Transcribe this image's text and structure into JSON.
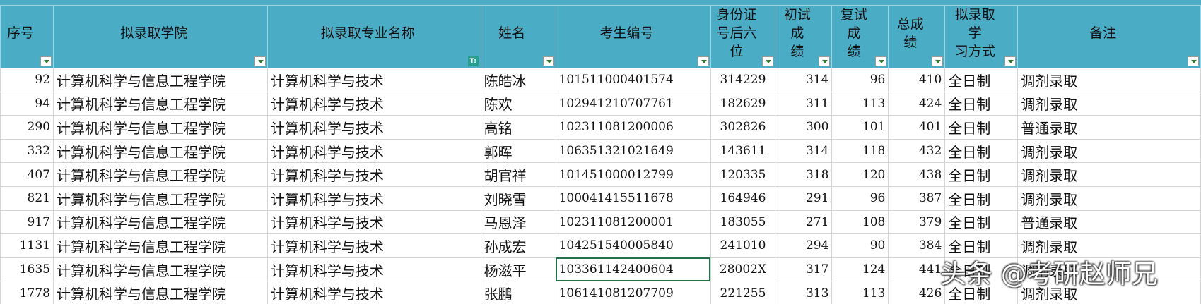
{
  "columns": [
    {
      "key": "seq",
      "label": "序号"
    },
    {
      "key": "college",
      "label": "拟录取学院"
    },
    {
      "key": "major",
      "label": "拟录取专业名称"
    },
    {
      "key": "name",
      "label": "姓名"
    },
    {
      "key": "exam_no",
      "label": "考生编号"
    },
    {
      "key": "id6",
      "label": "身份证\n号后六\n位"
    },
    {
      "key": "first",
      "label": "初试成\n绩"
    },
    {
      "key": "retest",
      "label": "复试成\n绩"
    },
    {
      "key": "total",
      "label": "总成\n绩"
    },
    {
      "key": "mode",
      "label": "拟录取学\n习方式"
    },
    {
      "key": "note",
      "label": "备注"
    }
  ],
  "rows": [
    {
      "seq": "92",
      "college": "计算机科学与信息工程学院",
      "major": "计算机科学与技术",
      "name": "陈皓冰",
      "exam_no": "101511000401574",
      "id6": "314229",
      "first": "314",
      "retest": "96",
      "total": "410",
      "mode": "全日制",
      "note": "调剂录取"
    },
    {
      "seq": "94",
      "college": "计算机科学与信息工程学院",
      "major": "计算机科学与技术",
      "name": "陈欢",
      "exam_no": "102941210707761",
      "id6": "182629",
      "first": "311",
      "retest": "113",
      "total": "424",
      "mode": "全日制",
      "note": "调剂录取"
    },
    {
      "seq": "290",
      "college": "计算机科学与信息工程学院",
      "major": "计算机科学与技术",
      "name": "高铭",
      "exam_no": "102311081200006",
      "id6": "302826",
      "first": "300",
      "retest": "101",
      "total": "401",
      "mode": "全日制",
      "note": "普通录取"
    },
    {
      "seq": "332",
      "college": "计算机科学与信息工程学院",
      "major": "计算机科学与技术",
      "name": "郭晖",
      "exam_no": "106351321021649",
      "id6": "143611",
      "first": "314",
      "retest": "118",
      "total": "432",
      "mode": "全日制",
      "note": "调剂录取"
    },
    {
      "seq": "407",
      "college": "计算机科学与信息工程学院",
      "major": "计算机科学与技术",
      "name": "胡官祥",
      "exam_no": "101451000012799",
      "id6": "120335",
      "first": "318",
      "retest": "120",
      "total": "438",
      "mode": "全日制",
      "note": "调剂录取"
    },
    {
      "seq": "821",
      "college": "计算机科学与信息工程学院",
      "major": "计算机科学与技术",
      "name": "刘晓雪",
      "exam_no": "100041415511678",
      "id6": "164946",
      "first": "291",
      "retest": "96",
      "total": "387",
      "mode": "全日制",
      "note": "调剂录取"
    },
    {
      "seq": "917",
      "college": "计算机科学与信息工程学院",
      "major": "计算机科学与技术",
      "name": "马恩泽",
      "exam_no": "102311081200001",
      "id6": "183055",
      "first": "271",
      "retest": "108",
      "total": "379",
      "mode": "全日制",
      "note": "普通录取"
    },
    {
      "seq": "1131",
      "college": "计算机科学与信息工程学院",
      "major": "计算机科学与技术",
      "name": "孙成宏",
      "exam_no": "104251540005840",
      "id6": "241010",
      "first": "294",
      "retest": "90",
      "total": "384",
      "mode": "全日制",
      "note": "调剂录取"
    },
    {
      "seq": "1635",
      "college": "计算机科学与信息工程学院",
      "major": "计算机科学与技术",
      "name": "杨滋平",
      "exam_no": "103361142400604",
      "id6": "28002X",
      "first": "317",
      "retest": "124",
      "total": "441",
      "mode": "全日制",
      "note": "调剂录取"
    },
    {
      "seq": "1778",
      "college": "计算机科学与信息工程学院",
      "major": "计算机科学与技术",
      "name": "张鹏",
      "exam_no": "106141081207709",
      "id6": "221255",
      "first": "313",
      "retest": "113",
      "total": "426",
      "mode": "全日制",
      "note": "调剂录取"
    }
  ],
  "selected_cell": {
    "row": 8,
    "column": "exam_no"
  },
  "watermark": "头条 @考研赵师兄",
  "colors": {
    "header_bg": "#4bacc6",
    "selection": "#217346",
    "filter_active": "#2a9d8f"
  }
}
